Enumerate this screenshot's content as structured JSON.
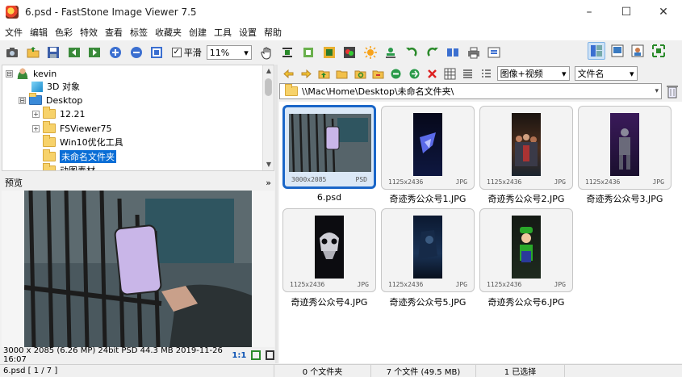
{
  "window": {
    "title": "6.psd  -  FastStone Image Viewer 7.5",
    "controls": [
      "–",
      "☐",
      "✕"
    ]
  },
  "menu": [
    "文件",
    "编辑",
    "色彩",
    "特效",
    "查看",
    "标签",
    "收藏夹",
    "创建",
    "工具",
    "设置",
    "帮助"
  ],
  "toolbar": {
    "smooth_label": "平滑",
    "smooth_checked": "✓",
    "zoom_value": "11%",
    "dropdown_arrow": "▾"
  },
  "tree": {
    "items": [
      {
        "label": "kevin",
        "expander": "⊟"
      },
      {
        "label": "3D 对象",
        "expander": ""
      },
      {
        "label": "Desktop",
        "expander": "⊟"
      },
      {
        "label": "12.21",
        "expander": "+"
      },
      {
        "label": "FSViewer75",
        "expander": "+"
      },
      {
        "label": "Win10优化工具",
        "expander": ""
      },
      {
        "label": "未命名文件夹",
        "expander": ""
      },
      {
        "label": "动图素材",
        "expander": ""
      }
    ]
  },
  "preview": {
    "header": "预览",
    "collapse": "»",
    "info": "3000 x 2085 (6.26 MP)  24bit  PSD   44.3 MB   2019-11-26 16:07",
    "ratio": "1:1"
  },
  "browser": {
    "view_mode": "图像+视频",
    "sort_by": "文件名",
    "address": "\\\\Mac\\Home\\Desktop\\未命名文件夹\\"
  },
  "thumbnails": [
    {
      "name": "6.psd",
      "dims": "3000x2085",
      "format": "PSD"
    },
    {
      "name": "奇迹秀公众号1.JPG",
      "dims": "1125x2436",
      "format": "JPG"
    },
    {
      "name": "奇迹秀公众号2.JPG",
      "dims": "1125x2436",
      "format": "JPG"
    },
    {
      "name": "奇迹秀公众号3.JPG",
      "dims": "1125x2436",
      "format": "JPG"
    },
    {
      "name": "奇迹秀公众号4.JPG",
      "dims": "1125x2436",
      "format": "JPG"
    },
    {
      "name": "奇迹秀公众号5.JPG",
      "dims": "1125x2436",
      "format": "JPG"
    },
    {
      "name": "奇迹秀公众号6.JPG",
      "dims": "1125x2436",
      "format": "JPG"
    }
  ],
  "status": {
    "file_index": "6.psd [ 1 / 7 ]",
    "folders": "0 个文件夹",
    "files": "7 个文件 (49.5 MB)",
    "selected": "1 已选择"
  },
  "colors": {
    "selection": "#0a6ed6",
    "thumb_selected_border": "#1a66c8",
    "folder_yellow": "#f7d26a"
  }
}
